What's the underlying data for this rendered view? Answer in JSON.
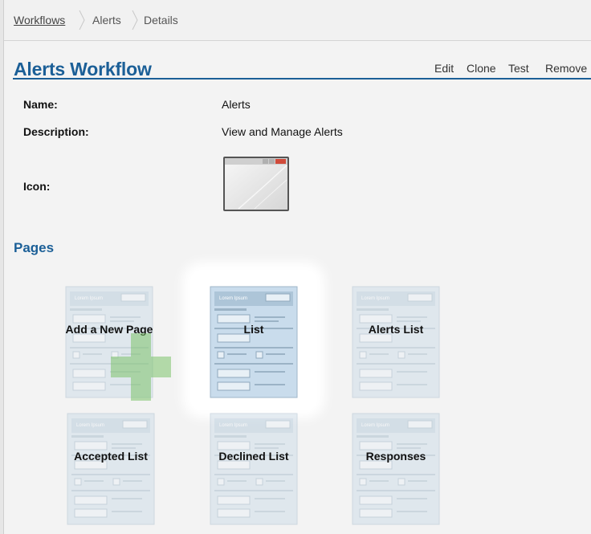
{
  "breadcrumb": {
    "items": [
      "Workflows",
      "Alerts",
      "Details"
    ]
  },
  "page": {
    "title": "Alerts Workflow"
  },
  "actions": {
    "edit": "Edit",
    "clone": "Clone",
    "test": "Test",
    "remove": "Remove"
  },
  "details": {
    "name_label": "Name:",
    "name_value": "Alerts",
    "description_label": "Description:",
    "description_value": "View and Manage Alerts",
    "icon_label": "Icon:"
  },
  "pages_section": {
    "title": "Pages",
    "tiles": [
      "Add a New Page",
      "List",
      "Alerts List",
      "Accepted List",
      "Declined List",
      "Responses"
    ],
    "selected": "List"
  },
  "thumb_text": "Lorem Ipsum",
  "colors": {
    "accent": "#1b5f97",
    "plus": "#7cc26a"
  }
}
